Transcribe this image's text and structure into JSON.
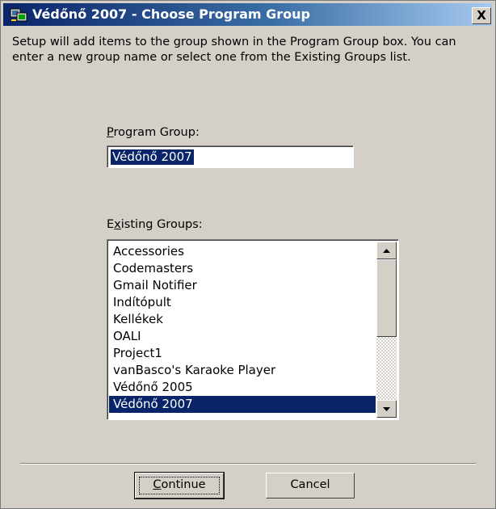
{
  "window": {
    "title": "Védőnő 2007 - Choose Program Group",
    "close_label": "X"
  },
  "intro_text": "Setup will add items to the group shown in the Program Group box. You can enter a new group name or select one from the Existing Groups list.",
  "program_group": {
    "label_accel": "P",
    "label_rest": "rogram Group:",
    "value": "Védőnő 2007"
  },
  "existing_groups": {
    "label_pre": "E",
    "label_accel": "x",
    "label_rest": "isting Groups:",
    "items": [
      "Accessories",
      "Codemasters",
      "Gmail Notifier",
      "Indítópult",
      "Kellékek",
      "OALI",
      "Project1",
      "vanBasco's Karaoke Player",
      "Védőnő 2005",
      "Védőnő 2007"
    ],
    "selected": "Védőnő 2007"
  },
  "buttons": {
    "continue_accel": "C",
    "continue_rest": "ontinue",
    "cancel": "Cancel"
  },
  "colors": {
    "title_start": "#0a246a",
    "title_end": "#a6caf0",
    "selection": "#0a246a",
    "face": "#d4d0c8"
  }
}
